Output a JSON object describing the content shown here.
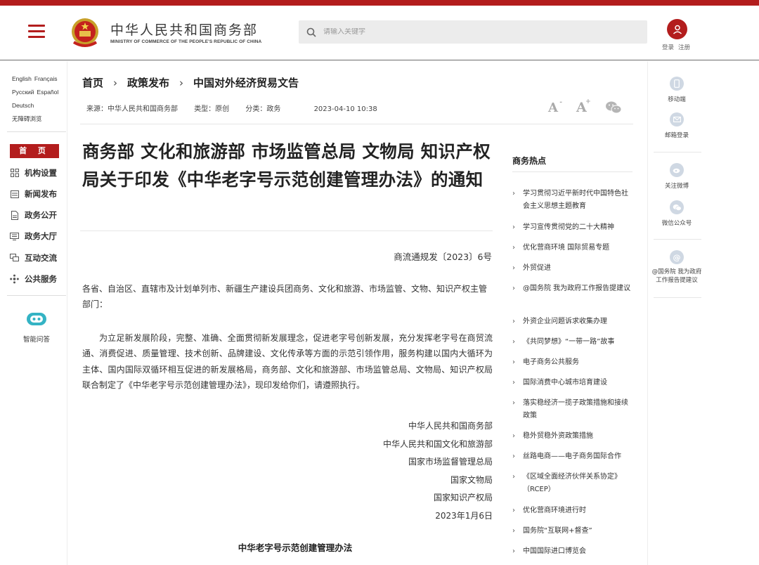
{
  "header": {
    "site_title": "中华人民共和国商务部",
    "site_subtitle": "MINISTRY OF COMMERCE OF THE PEOPLE'S REPUBLIC OF CHINA",
    "search_placeholder": "请输入关键字",
    "login_label": "登录",
    "register_label": "注册"
  },
  "left_nav": {
    "languages": [
      "English",
      "Français",
      "Русский",
      "Español",
      "Deutsch",
      "无障碍浏览"
    ],
    "home_label": "首 页",
    "items": [
      {
        "label": "机构设置",
        "icon": "org-chart-icon"
      },
      {
        "label": "新闻发布",
        "icon": "news-icon"
      },
      {
        "label": "政务公开",
        "icon": "document-icon"
      },
      {
        "label": "政务大厅",
        "icon": "keyboard-icon"
      },
      {
        "label": "互动交流",
        "icon": "chat-icon"
      },
      {
        "label": "公共服务",
        "icon": "service-icon"
      }
    ],
    "assistant_label": "智能问答"
  },
  "breadcrumb": [
    "首页",
    "政策发布",
    "中国对外经济贸易文告"
  ],
  "meta": {
    "source": "来源：中华人民共和国商务部",
    "type": "类型：原创",
    "category": "分类：政务",
    "date": "2023-04-10 10:38"
  },
  "tools": {
    "font_small": "A",
    "font_large": "A",
    "font_small_sup": "-",
    "font_large_sup": "+"
  },
  "article": {
    "title": "商务部 文化和旅游部 市场监管总局 文物局 知识产权局关于印发《中华老字号示范创建管理办法》的通知",
    "doc_number": "商流通规发〔2023〕6号",
    "addressee": "各省、自治区、直辖市及计划单列市、新疆生产建设兵团商务、文化和旅游、市场监管、文物、知识产权主管部门：",
    "body": "为立足新发展阶段，完整、准确、全面贯彻新发展理念，促进老字号创新发展，充分发挥老字号在商贸流通、消费促进、质量管理、技术创新、品牌建设、文化传承等方面的示范引领作用，服务构建以国内大循环为主体、国内国际双循环相互促进的新发展格局，商务部、文化和旅游部、市场监管总局、文物局、知识产权局联合制定了《中华老字号示范创建管理办法》，现印发给你们，请遵照执行。",
    "signers": [
      "中华人民共和国商务部",
      "中华人民共和国文化和旅游部",
      "国家市场监督管理总局",
      "国家文物局",
      "国家知识产权局",
      "2023年1月6日"
    ],
    "attachment_title": "中华老字号示范创建管理办法"
  },
  "hot_topics": {
    "title": "商务热点",
    "items": [
      "学习贯彻习近平新时代中国特色社会主义思想主题教育",
      "学习宣传贯彻党的二十大精神",
      "优化营商环境 国际贸易专题",
      "外贸促进",
      "@国务院 我为政府工作报告提建议",
      "外资企业问题诉求收集办理",
      "《共同梦想》“一带一路”故事",
      "电子商务公共服务",
      "国际消费中心城市培育建设",
      "落实稳经济一揽子政策措施和接续政策",
      "稳外贸稳外资政策措施",
      "丝路电商——电子商务国际合作",
      "《区域全面经济伙伴关系协定》（RCEP）",
      "优化营商环境进行时",
      "国务院“互联网+督查”",
      "中国国际进口博览会"
    ]
  },
  "right_nav": {
    "items": [
      {
        "label": "移动端",
        "icon": "mobile-icon"
      },
      {
        "label": "邮箱登录",
        "icon": "mail-icon"
      },
      {
        "label": "关注微博",
        "icon": "weibo-icon"
      },
      {
        "label": "微信公众号",
        "icon": "wechat-icon"
      },
      {
        "label": "@国务院 我为政府工作报告提建议",
        "icon": "at-icon"
      }
    ]
  },
  "colors": {
    "brand_red": "#b31d1d",
    "icon_blue": "#cfd8e3"
  }
}
